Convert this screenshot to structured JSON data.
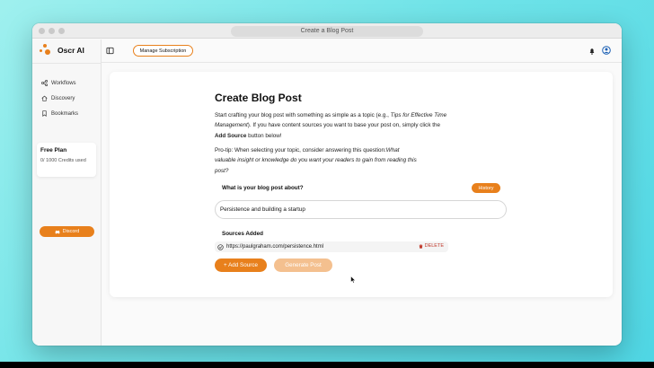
{
  "window": {
    "title": "Create a Blog Post"
  },
  "sidebar": {
    "brand": "Oscr AI",
    "items": [
      {
        "label": "Workflows",
        "icon": "workflow-icon"
      },
      {
        "label": "Discovery",
        "icon": "home-icon"
      },
      {
        "label": "Bookmarks",
        "icon": "bookmark-icon"
      }
    ],
    "plan": {
      "title": "Free Plan",
      "credits": "0/ 1000 Credits used"
    },
    "discord_label": "Discord"
  },
  "topbar": {
    "manage_label": "Manage Subscription"
  },
  "main": {
    "title": "Create Blog Post",
    "intro_1": "Start crafting your blog post with something as simple as a topic (e.g., ",
    "intro_example": "Tips for Effective Time Management",
    "intro_2": "). If you have content sources you want to base your post on, simply click the ",
    "intro_button_name": "Add Source",
    "intro_3": " button below!",
    "protip_1": "Pro-tip: When selecting your topic, consider answering this question:",
    "protip_question": "What valuable insight or knowledge do you want your readers to gain from reading this post?",
    "question_label": "What is your blog post about?",
    "history_label": "History",
    "topic_value": "Persistence and building a startup",
    "sources_label": "Sources Added",
    "sources": [
      {
        "url": "https://paulgraham.com/persistence.html"
      }
    ],
    "delete_label": "DELETE",
    "add_source_label": "+ Add Source",
    "generate_label": "Generate Post"
  },
  "colors": {
    "accent": "#e8801c",
    "accent_disabled": "#f4c08f",
    "delete": "#c0392b"
  }
}
